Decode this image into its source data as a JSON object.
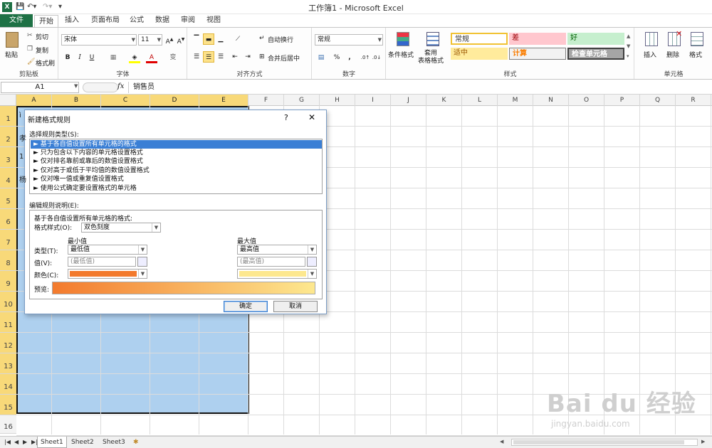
{
  "window": {
    "title": "工作簿1 - Microsoft Excel"
  },
  "tabs": [
    {
      "label": "文件"
    },
    {
      "label": "开始"
    },
    {
      "label": "插入"
    },
    {
      "label": "页面布局"
    },
    {
      "label": "公式"
    },
    {
      "label": "数据"
    },
    {
      "label": "审阅"
    },
    {
      "label": "视图"
    }
  ],
  "ribbon": {
    "clipboard": {
      "label": "剪贴板",
      "paste": "粘贴",
      "cut": "剪切",
      "copy": "复制",
      "format_painter": "格式刷"
    },
    "font": {
      "label": "字体",
      "name": "宋体",
      "size": "11",
      "bold": "B",
      "italic": "I",
      "underline": "U",
      "font_color_glyph": "A",
      "phonetic_glyph": "变"
    },
    "alignment": {
      "label": "对齐方式",
      "wrap": "自动换行",
      "merge": "合并后居中"
    },
    "number": {
      "label": "数字",
      "format": "常规",
      "percent": "%",
      "comma": ","
    },
    "conditional": {
      "label": "条件格式"
    },
    "table_format": {
      "label": "套用\n表格格式"
    },
    "styles": {
      "label": "样式",
      "normal": "常规",
      "bad": "差",
      "good": "好",
      "neutral": "适中",
      "calculation": "计算",
      "check_cell": "检查单元格"
    },
    "cells": {
      "label": "单元格",
      "insert": "插入",
      "delete": "删除",
      "format": "格式"
    }
  },
  "formula_bar": {
    "name_box": "A1",
    "fx": "fx",
    "content": "销售员"
  },
  "grid": {
    "columns": [
      "A",
      "B",
      "C",
      "D",
      "E",
      "F",
      "G",
      "H",
      "I",
      "J",
      "K",
      "L",
      "M",
      "N",
      "O",
      "P",
      "Q",
      "R"
    ],
    "rows": [
      "1",
      "2",
      "3",
      "4",
      "5",
      "6",
      "7",
      "8",
      "9",
      "10",
      "11",
      "12",
      "13",
      "14",
      "15",
      "16"
    ],
    "visible_cell_fragments": [
      "ì",
      "孝",
      "1",
      "杨"
    ]
  },
  "sheets": [
    {
      "name": "Sheet1"
    },
    {
      "name": "Sheet2"
    },
    {
      "name": "Sheet3"
    }
  ],
  "dialog": {
    "title": "新建格式规则",
    "help": "?",
    "close": "✕",
    "select_rule_type": "选择规则类型(S):",
    "rule_types": [
      "► 基于各自值设置所有单元格的格式",
      "► 只为包含以下内容的单元格设置格式",
      "► 仅对排名靠前或靠后的数值设置格式",
      "► 仅对高于或低于平均值的数值设置格式",
      "► 仅对唯一值或重复值设置格式",
      "► 使用公式确定要设置格式的单元格"
    ],
    "edit_rule_desc": "编辑规则说明(E):",
    "desc_heading": "基于各自值设置所有单元格的格式:",
    "format_style_label": "格式样式(O):",
    "format_style_value": "双色刻度",
    "min_header": "最小值",
    "max_header": "最大值",
    "type_label": "类型(T):",
    "min_type": "最低值",
    "max_type": "最高值",
    "value_label": "值(V):",
    "min_value_placeholder": "(最低值)",
    "max_value_placeholder": "(最高值)",
    "color_label": "颜色(C):",
    "min_color": "#f37a2d",
    "max_color": "#fde88f",
    "preview_label": "预览:",
    "ok": "确定",
    "cancel": "取消"
  },
  "watermark": {
    "brand": "Bai du 经验",
    "url": "jingyan.baidu.com"
  }
}
